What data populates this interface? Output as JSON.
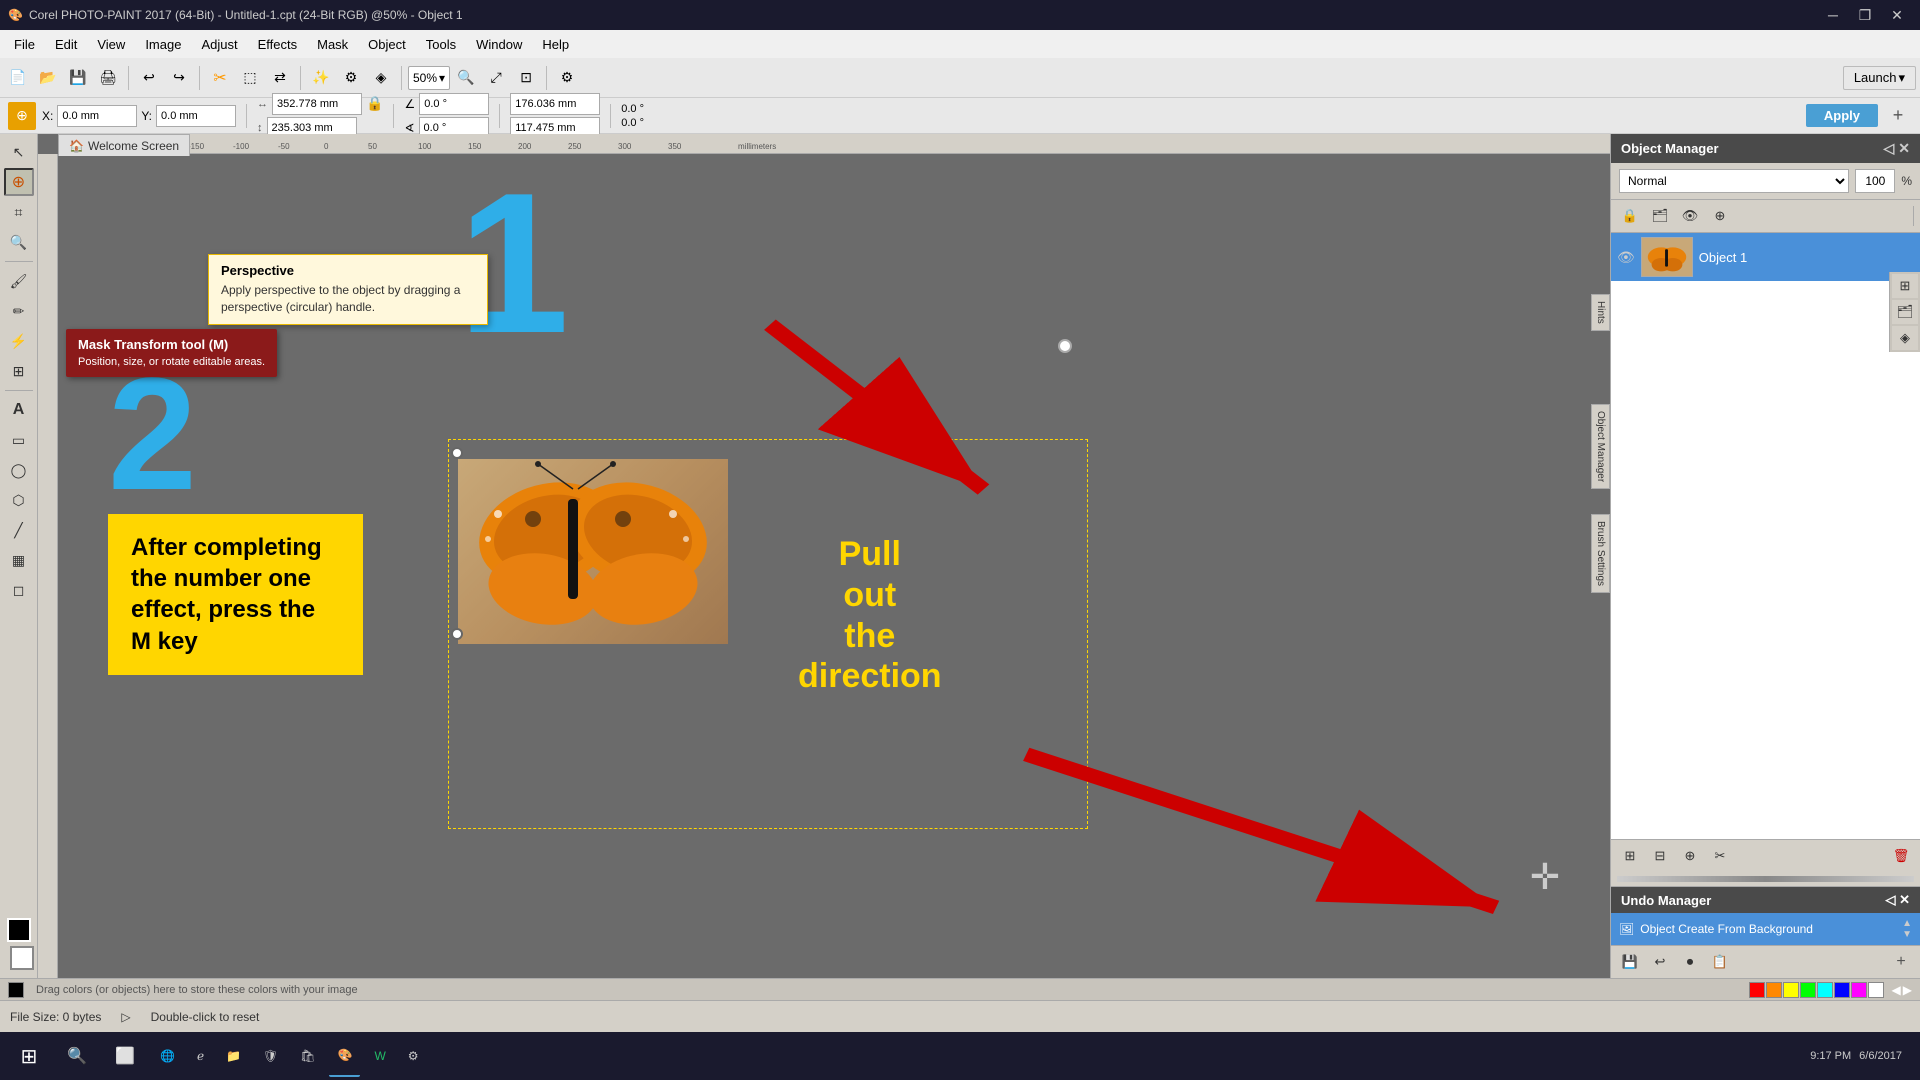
{
  "titlebar": {
    "title": "Corel PHOTO-PAINT 2017 (64-Bit) - Untitled-1.cpt (24-Bit RGB) @50% - Object 1",
    "minimize": "─",
    "restore": "❐",
    "close": "✕"
  },
  "menubar": {
    "items": [
      "File",
      "Edit",
      "View",
      "Image",
      "Adjust",
      "Effects",
      "Mask",
      "Object",
      "Tools",
      "Window",
      "Help"
    ]
  },
  "toolbar1": {
    "zoom_label": "50%",
    "launch_label": "Launch"
  },
  "toolbar2": {
    "x_label": "X:",
    "y_label": "Y:",
    "x_value": "0.0 mm",
    "y_value": "0.0 mm",
    "w_label": "352.778 mm",
    "h_label": "235.303 mm",
    "angle1": "0.0 °",
    "angle2": "0.0 °",
    "w2": "176.036 mm",
    "h2": "117.475 mm",
    "apply": "Apply"
  },
  "welcome_tab": {
    "label": "Welcome Screen"
  },
  "canvas": {
    "number1": "1",
    "number2": "2",
    "yellow_text": "After completing the number one effect, press the M key",
    "pull_text": "Pull\nout\nthe\ndirection"
  },
  "tooltip": {
    "title": "Perspective",
    "body": "Apply perspective to the object by dragging a perspective (circular) handle."
  },
  "mask_tooltip": {
    "title": "Mask Transform tool (M)",
    "body": "Position, size, or rotate editable areas."
  },
  "object_manager": {
    "title": "Object Manager",
    "blend_mode": "Normal",
    "opacity": "100",
    "pct": "%",
    "obj1_name": "Object 1"
  },
  "undo_manager": {
    "title": "Undo Manager",
    "item1": "Object Create From Background"
  },
  "statusbar": {
    "filesize": "File Size: 0 bytes",
    "hint": "Double-click to reset"
  },
  "colorstrip": {
    "drag_hint": "Drag colors (or objects) here to store these colors with your image"
  },
  "taskbar": {
    "time": "9:17 PM",
    "date": "6/6/2017"
  }
}
